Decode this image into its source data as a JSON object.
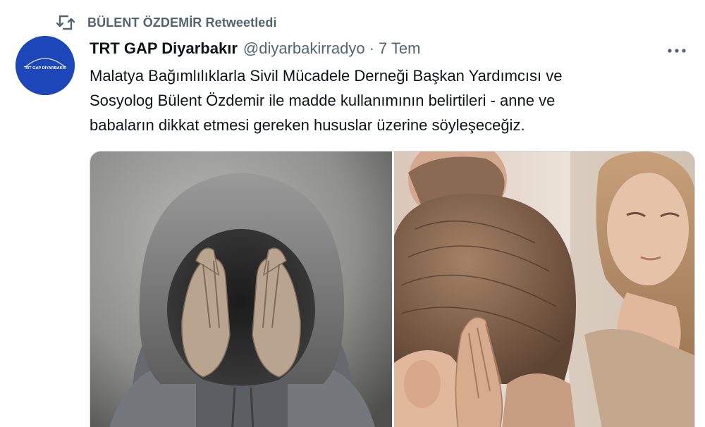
{
  "retweet": {
    "icon": "retweet-icon",
    "text": "BÜLENT ÖZDEMİR Retweetledi"
  },
  "author": {
    "display_name": "TRT GAP Diyarbakır",
    "handle": "@diyarbakirradyo",
    "separator": "·",
    "time": "7 Tem",
    "avatar_text": "TRT GAP DİYARBAKIR",
    "avatar_color": "#1d46b8"
  },
  "more_icon": "more-icon",
  "text_lines": [
    "Malatya Bağımlılıklarla Sivil Mücadele Derneği Başkan Yardımcısı ve",
    "Sosyolog Bülent Özdemir ile madde kullanımının belirtileri - anne ve",
    "babaların dikkat etmesi gereken hususlar üzerine söyleşeceğiz."
  ],
  "media": [
    {
      "name": "hooded-person-photo"
    },
    {
      "name": "worried-parents-photo"
    }
  ],
  "colors": {
    "secondary_text": "#536471",
    "primary_text": "#0f1419"
  }
}
